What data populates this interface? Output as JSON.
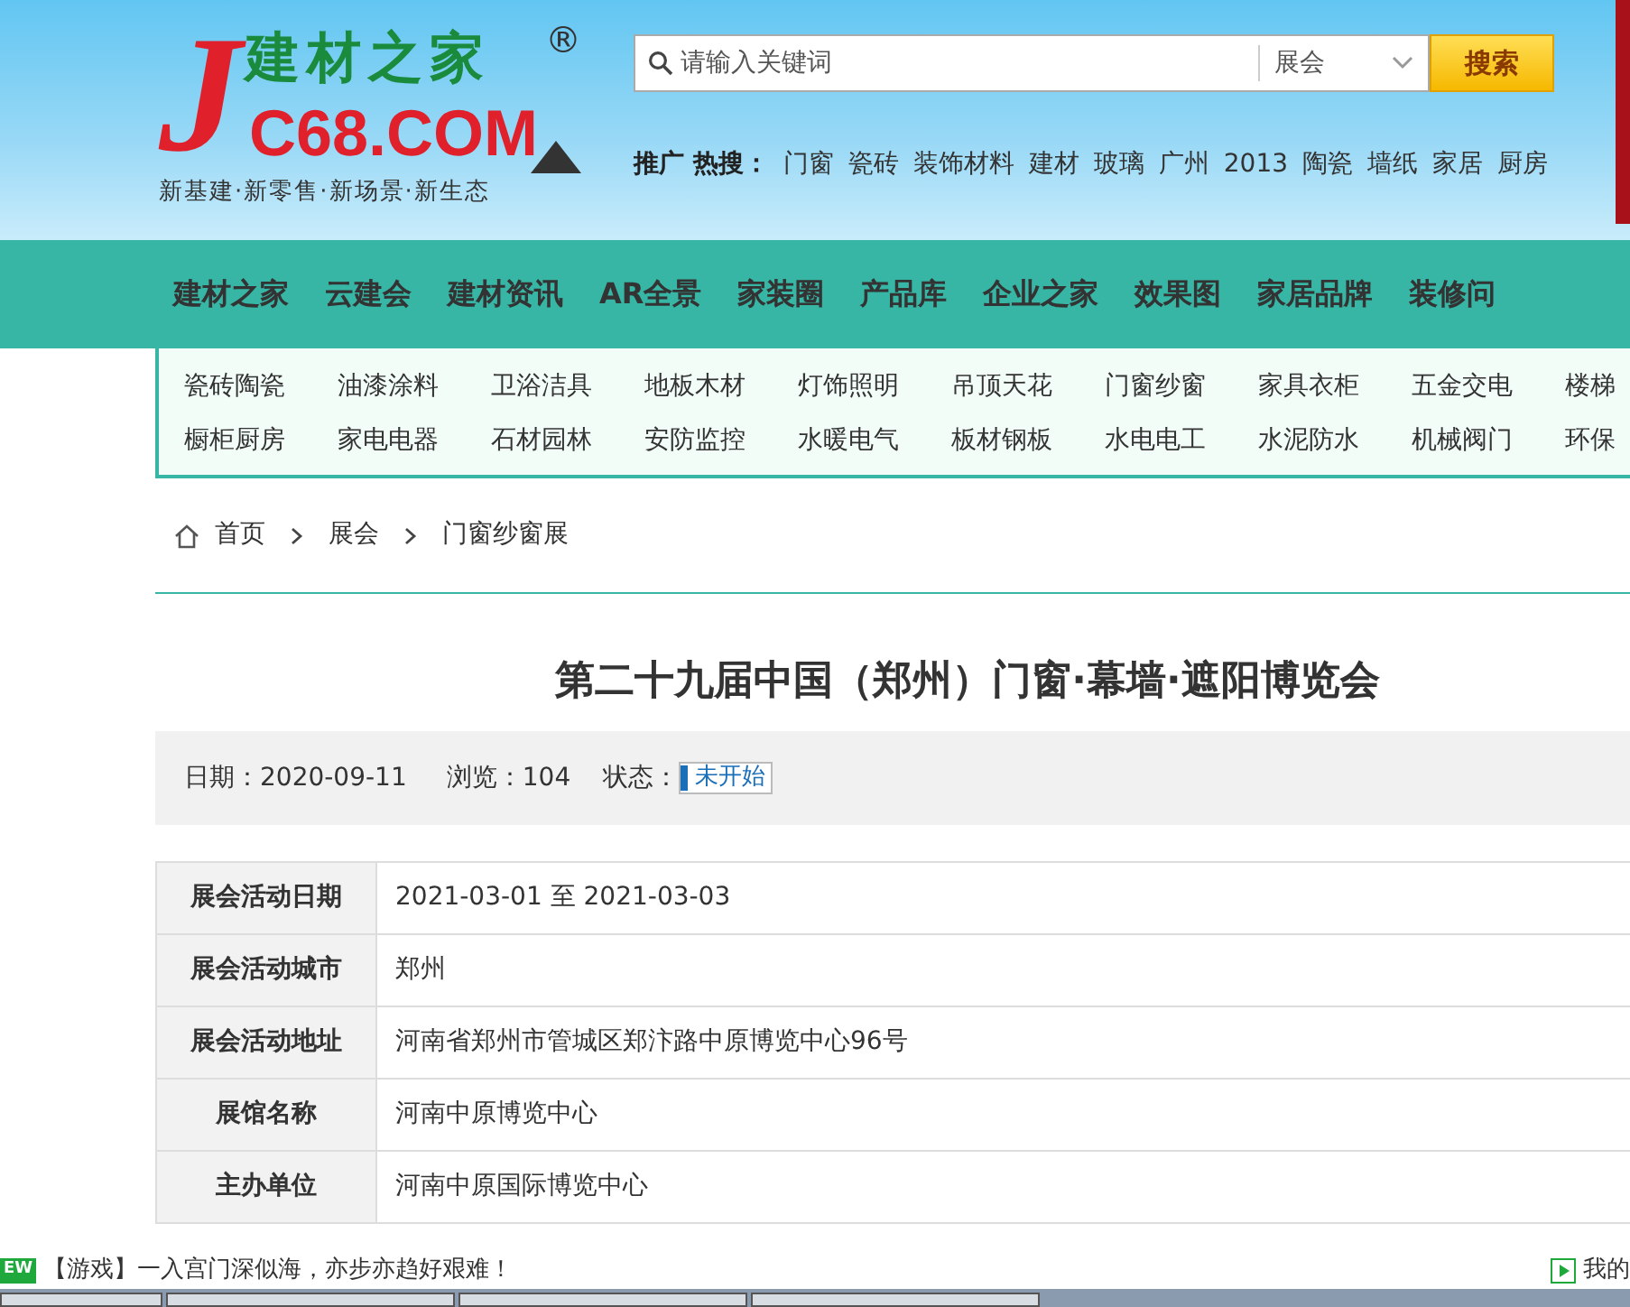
{
  "logo": {
    "letter": "J",
    "name": "建材之家",
    "registered": "®",
    "domain": "C68.COM",
    "slogan": "新基建·新零售·新场景·新生态"
  },
  "search": {
    "placeholder": "请输入关键词",
    "category": "展会",
    "button": "搜索"
  },
  "hot_search": {
    "label": "推广 热搜：",
    "terms": [
      "门窗",
      "瓷砖",
      "装饰材料",
      "建材",
      "玻璃",
      "广州",
      "2013",
      "陶瓷",
      "墙纸",
      "家居",
      "厨房"
    ]
  },
  "main_nav": [
    "建材之家",
    "云建会",
    "建材资讯",
    "AR全景",
    "家装圈",
    "产品库",
    "企业之家",
    "效果图",
    "家居品牌",
    "装修问"
  ],
  "categories": [
    [
      "瓷砖陶瓷",
      "油漆涂料",
      "卫浴洁具",
      "地板木材",
      "灯饰照明",
      "吊顶天花",
      "门窗纱窗",
      "家具衣柜",
      "五金交电",
      "楼梯"
    ],
    [
      "橱柜厨房",
      "家电电器",
      "石材园林",
      "安防监控",
      "水暖电气",
      "板材钢板",
      "水电电工",
      "水泥防水",
      "机械阀门",
      "环保"
    ]
  ],
  "breadcrumb": [
    "首页",
    "展会",
    "门窗纱窗展"
  ],
  "title": "第二十九届中国（郑州）门窗·幕墙·遮阳博览会",
  "meta": {
    "date_label": "日期：",
    "date": "2020-09-11",
    "views_label": "浏览：",
    "views": "104",
    "status_label": "状态：",
    "status": "未开始"
  },
  "details": [
    {
      "label": "展会活动日期",
      "value": "2021-03-01 至 2021-03-03"
    },
    {
      "label": "展会活动城市",
      "value": "郑州"
    },
    {
      "label": "展会活动地址",
      "value": "河南省郑州市管城区郑汴路中原博览中心96号"
    },
    {
      "label": "展馆名称",
      "value": "河南中原博览中心"
    },
    {
      "label": "主办单位",
      "value": "河南中原国际博览中心"
    }
  ],
  "ticker": {
    "badge": "EW",
    "text": "【游戏】一入宫门深似海，亦步亦趋好艰难！",
    "right": "我的"
  }
}
